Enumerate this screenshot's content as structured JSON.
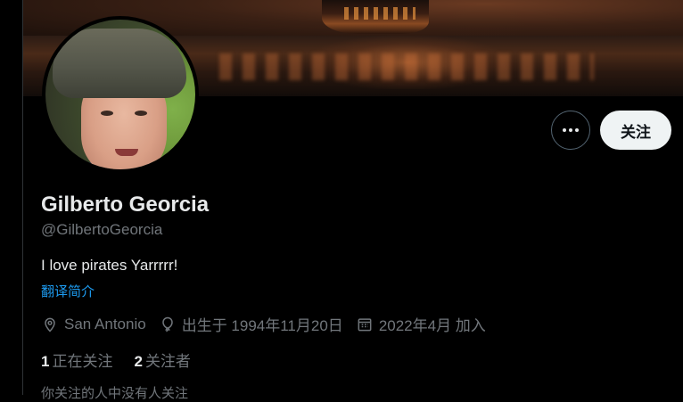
{
  "profile": {
    "name": "Gilberto Georcia",
    "handle": "@GilbertoGeorcia",
    "bio": "I love pirates Yarrrrr!",
    "translate_label": "翻译简介"
  },
  "actions": {
    "more_icon": "more-horizontal-icon",
    "follow_label": "关注"
  },
  "meta": {
    "location": "San Antonio",
    "birthday": "出生于 1994年11月20日",
    "joined": "2022年4月 加入"
  },
  "stats": {
    "following_count": "1",
    "following_label": "正在关注",
    "followers_count": "2",
    "followers_label": "关注者"
  },
  "known_followers": "你关注的人中没有人关注",
  "colors": {
    "background": "#000000",
    "text_primary": "#e7e9ea",
    "text_secondary": "#71767b",
    "link": "#1d9bf0",
    "follow_button_bg": "#eff3f4"
  }
}
